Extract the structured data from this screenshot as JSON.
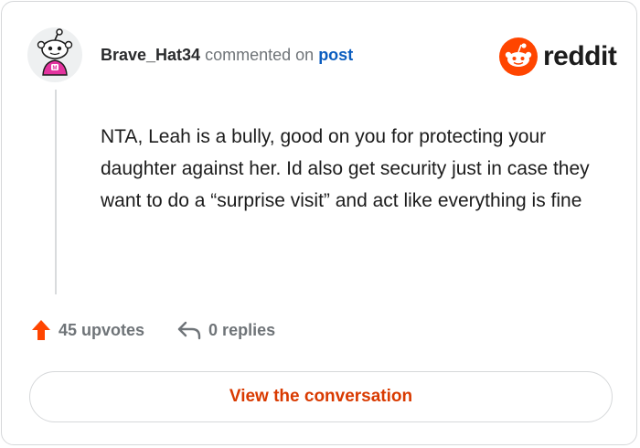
{
  "brand": {
    "logo_text": "reddit",
    "accent_color": "#ff4500"
  },
  "comment": {
    "author": "Brave_Hat34",
    "action_text": "commented on",
    "target_link": "post",
    "body": "NTA, Leah is a bully, good on you for protecting your daughter against her. Id also get security just in case they want to do a “surprise visit” and act like everything is fine",
    "avatar_icon": "snoo-avatar-icon"
  },
  "stats": {
    "upvotes_label": "45 upvotes",
    "upvote_icon": "upvote-arrow-icon",
    "replies_label": "0 replies",
    "reply_icon": "reply-arrow-icon"
  },
  "cta": {
    "label": "View the conversation"
  }
}
